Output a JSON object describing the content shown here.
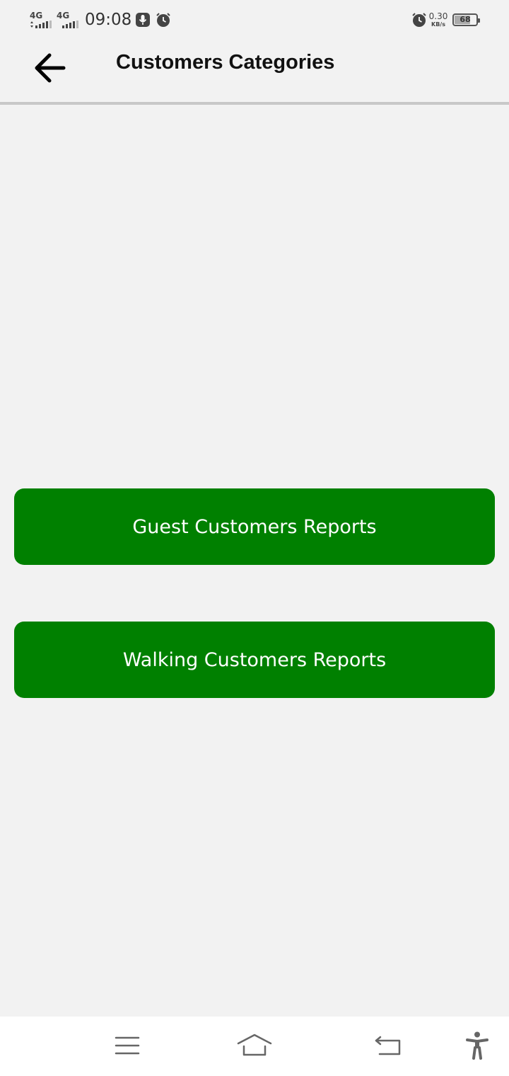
{
  "status_bar": {
    "network_1": "4G",
    "network_2": "4G",
    "time": "09:08",
    "data_rate": "0.30",
    "data_rate_unit": "KB/s",
    "battery_level": "68",
    "icons": [
      "signal-icon",
      "signal-icon",
      "mic-icon",
      "alarm-icon",
      "alarm-icon",
      "battery-icon"
    ]
  },
  "app_bar": {
    "title": "Customers Categories",
    "back_icon": "arrow-left-icon"
  },
  "main": {
    "buttons": [
      {
        "label": "Guest Customers Reports"
      },
      {
        "label": "Walking Customers Reports"
      }
    ],
    "button_color": "#008000",
    "background_color": "#f2f2f2"
  },
  "nav_bar": {
    "icons": [
      "menu-icon",
      "home-icon",
      "back-icon",
      "accessibility-icon"
    ]
  }
}
